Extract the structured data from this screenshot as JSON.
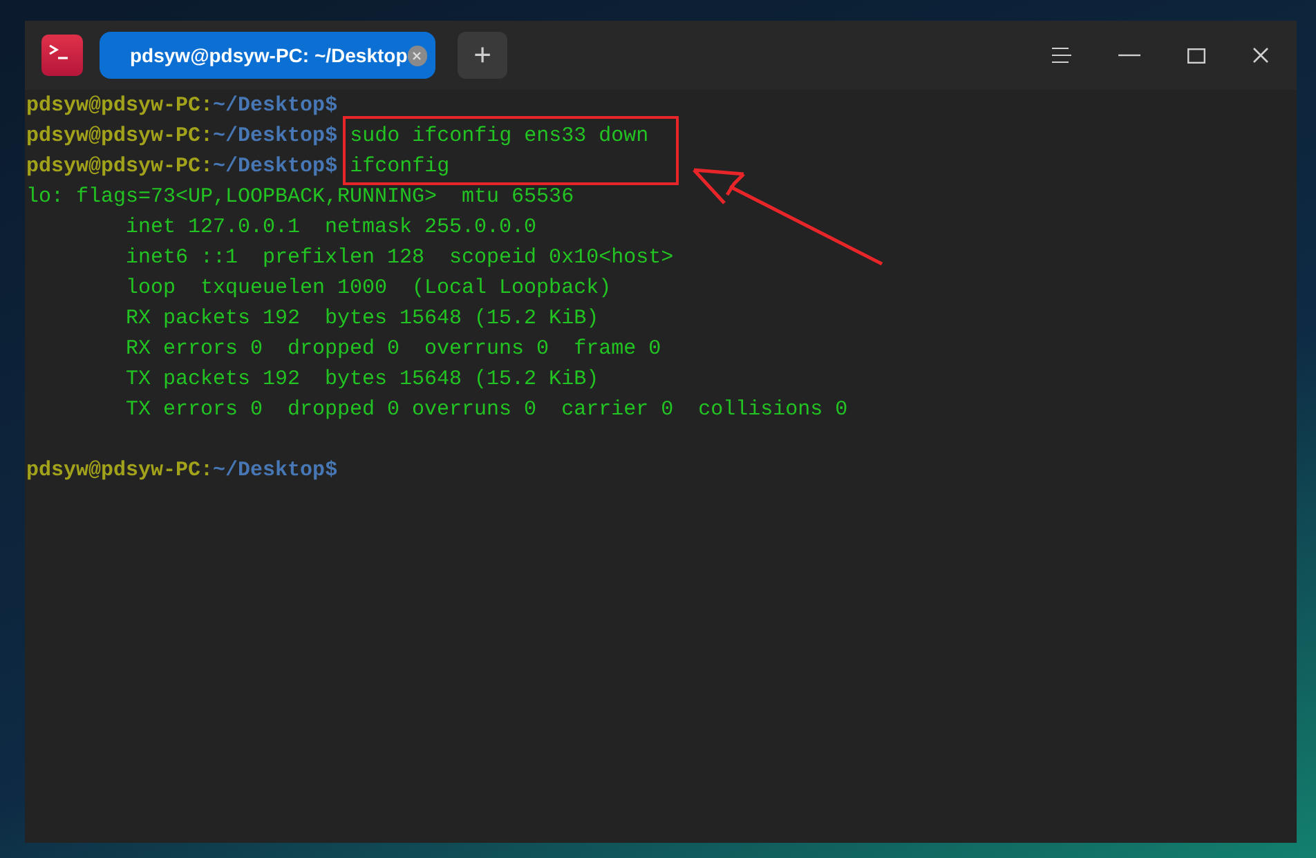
{
  "window": {
    "tab": {
      "title": "pdsyw@pdsyw-PC: ~/Desktop",
      "selected": true
    },
    "new_tab": "+"
  },
  "terminal": {
    "lines": [
      {
        "kind": "prompt",
        "user": "pdsyw@pdsyw-PC",
        "sep": ":",
        "path": "~/Desktop",
        "symbol": "$"
      },
      {
        "kind": "prompt",
        "user": "pdsyw@pdsyw-PC",
        "sep": ":",
        "path": "~/Desktop",
        "symbol": "$",
        "command": "sudo ifconfig ens33 down"
      },
      {
        "kind": "prompt",
        "user": "pdsyw@pdsyw-PC",
        "sep": ":",
        "path": "~/Desktop",
        "symbol": "$",
        "command": "ifconfig"
      },
      {
        "kind": "output",
        "text": "lo: flags=73<UP,LOOPBACK,RUNNING>  mtu 65536"
      },
      {
        "kind": "output",
        "text": "        inet 127.0.0.1  netmask 255.0.0.0"
      },
      {
        "kind": "output",
        "text": "        inet6 ::1  prefixlen 128  scopeid 0x10<host>"
      },
      {
        "kind": "output",
        "text": "        loop  txqueuelen 1000  (Local Loopback)"
      },
      {
        "kind": "output",
        "text": "        RX packets 192  bytes 15648 (15.2 KiB)"
      },
      {
        "kind": "output",
        "text": "        RX errors 0  dropped 0  overruns 0  frame 0"
      },
      {
        "kind": "output",
        "text": "        TX packets 192  bytes 15648 (15.2 KiB)"
      },
      {
        "kind": "output",
        "text": "        TX errors 0  dropped 0 overruns 0  carrier 0  collisions 0"
      },
      {
        "kind": "blank"
      },
      {
        "kind": "prompt",
        "user": "pdsyw@pdsyw-PC",
        "sep": ":",
        "path": "~/Desktop",
        "symbol": "$"
      }
    ]
  }
}
